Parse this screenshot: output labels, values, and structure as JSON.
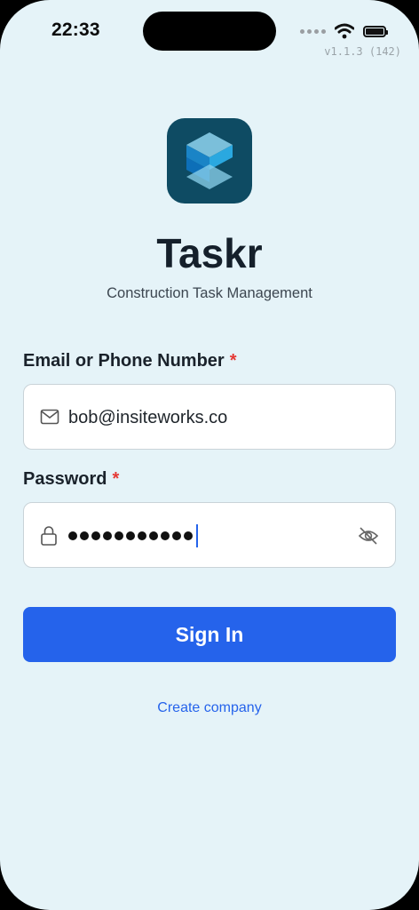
{
  "status_bar": {
    "time": "22:33",
    "version": "v1.1.3 (142)",
    "icons": [
      "cellular-dots-icon",
      "wifi-icon",
      "battery-icon"
    ]
  },
  "app": {
    "name": "Taskr",
    "subtitle": "Construction Task Management",
    "logo_colors": {
      "background": "#0e4b63",
      "light": "#8ed3ee",
      "mid": "#2aa8e0",
      "dark": "#0d6fb8"
    }
  },
  "form": {
    "email": {
      "label": "Email or Phone Number",
      "required_mark": "*",
      "value": "bob@insiteworks.co",
      "icon": "mail-icon"
    },
    "password": {
      "label": "Password",
      "required_mark": "*",
      "masked_length": 11,
      "icon": "lock-icon",
      "toggle_icon": "eye-off-icon"
    }
  },
  "actions": {
    "sign_in": "Sign In",
    "create_company": "Create company"
  },
  "colors": {
    "background": "#e5f3f8",
    "primary": "#2563eb",
    "required": "#e53935",
    "text": "#1a222b"
  }
}
